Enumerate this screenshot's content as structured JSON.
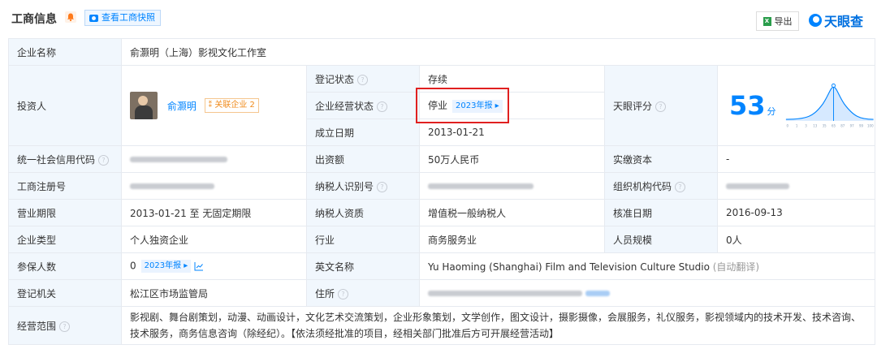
{
  "header": {
    "title": "工商信息",
    "snapshot_button": "查看工商快照",
    "export_button": "导出",
    "logo_text": "天眼查"
  },
  "table": {
    "company_name_label": "企业名称",
    "company_name": "俞灏明（上海）影视文化工作室",
    "investor_label": "投资人",
    "investor_name": "俞灏明",
    "investor_related": "关联企业 2",
    "reg_status_label": "登记状态",
    "reg_status": "存续",
    "op_status_label": "企业经营状态",
    "op_status": "停业",
    "op_status_report": "2023年报",
    "established_label": "成立日期",
    "established": "2013-01-21",
    "tianyan_label": "天眼评分",
    "score": "53",
    "score_unit": "分",
    "score_axis": [
      "0",
      "1",
      "3",
      "13",
      "35",
      "65",
      "87",
      "97",
      "99",
      "100"
    ],
    "credit_code_label": "统一社会信用代码",
    "capital_label": "出资额",
    "capital": "50万人民币",
    "paidin_label": "实缴资本",
    "paidin": "-",
    "reg_no_label": "工商注册号",
    "taxpayer_id_label": "纳税人识别号",
    "org_code_label": "组织机构代码",
    "term_label": "营业期限",
    "term": "2013-01-21 至 无固定期限",
    "tax_qual_label": "纳税人资质",
    "tax_qual": "增值税一般纳税人",
    "approval_label": "核准日期",
    "approval": "2016-09-13",
    "type_label": "企业类型",
    "type": "个人独资企业",
    "industry_label": "行业",
    "industry": "商务服务业",
    "staff_label": "人员规模",
    "staff": "0人",
    "insured_label": "参保人数",
    "insured": "0",
    "insured_report": "2023年报",
    "english_label": "英文名称",
    "english": "Yu Haoming (Shanghai) Film and Television Culture Studio",
    "english_note": "(自动翻译)",
    "authority_label": "登记机关",
    "authority": "松江区市场监管局",
    "address_label": "住所",
    "scope_label": "经营范围",
    "scope": "影视剧、舞台剧策划，动漫、动画设计，文化艺术交流策划，企业形象策划，文学创作，图文设计，摄影摄像，会展服务，礼仪服务，影视领域内的技术开发、技术咨询、技术服务，商务信息咨询（除经纪）。【依法须经批准的项目，经相关部门批准后方可开展经营活动】"
  },
  "colors": {
    "accent": "#0084ff",
    "label_bg": "#f1f7fd",
    "status_green": "#1aa54c",
    "highlight_red": "#e02020"
  }
}
